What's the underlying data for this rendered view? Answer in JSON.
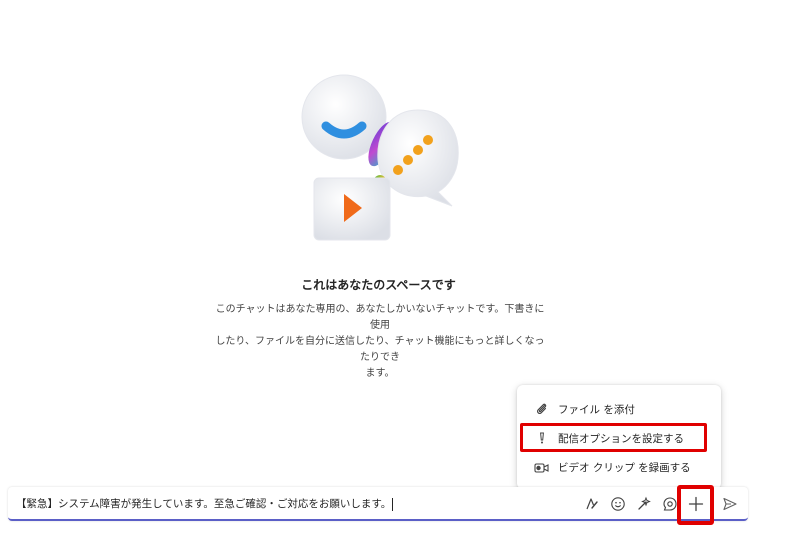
{
  "empty_state": {
    "title": "これはあなたのスペースです",
    "desc_line1": "このチャットはあなた専用の、あなたしかいないチャットです。下書きに使用",
    "desc_line2": "したり、ファイルを自分に送信したり、チャット機能にもっと詳しくなったりでき",
    "desc_line3": "ます。"
  },
  "menu": {
    "items": [
      {
        "label": "ファイル を添付",
        "icon": "paperclip-icon"
      },
      {
        "label": "配信オプションを設定する",
        "icon": "exclamation-icon"
      },
      {
        "label": "ビデオ クリップ を録画する",
        "icon": "video-clip-icon"
      }
    ]
  },
  "compose": {
    "value": "【緊急】システム障害が発生しています。至急ご確認・ご対応をお願いします。",
    "tools": [
      "format-icon",
      "emoji-icon",
      "copilot-icon",
      "loop-icon",
      "plus-icon",
      "send-icon"
    ]
  },
  "colors": {
    "accent": "#5b5fc7",
    "highlight": "#e00000"
  }
}
